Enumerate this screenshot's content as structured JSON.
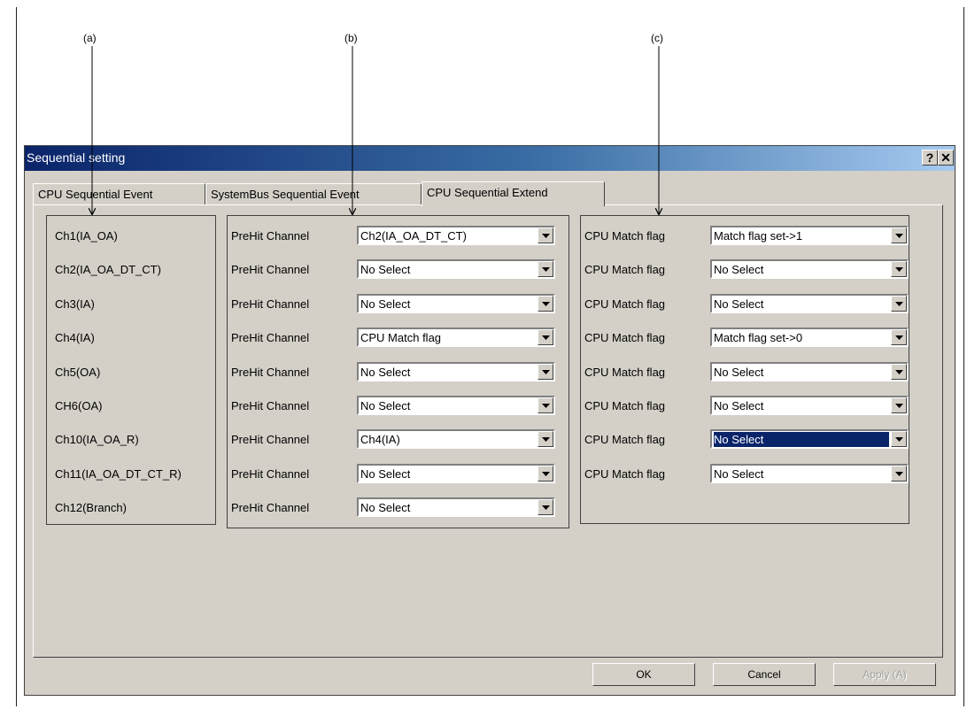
{
  "callouts": {
    "a": "(a)",
    "b": "(b)",
    "c": "(c)"
  },
  "dialog": {
    "title": "Sequential setting",
    "help_button": "?",
    "close_button": "✕"
  },
  "tabs": [
    {
      "label": "CPU Sequential Event"
    },
    {
      "label": "SystemBus Sequential Event"
    },
    {
      "label": "CPU Sequential Extend"
    }
  ],
  "channels": [
    {
      "name": "Ch1(IA_OA)",
      "prehit_label": "PreHit Channel",
      "prehit_value": "Ch2(IA_OA_DT_CT)"
    },
    {
      "name": "Ch2(IA_OA_DT_CT)",
      "prehit_label": "PreHit Channel",
      "prehit_value": "No Select"
    },
    {
      "name": "Ch3(IA)",
      "prehit_label": "PreHit Channel",
      "prehit_value": "No Select"
    },
    {
      "name": "Ch4(IA)",
      "prehit_label": "PreHit Channel",
      "prehit_value": "CPU Match flag"
    },
    {
      "name": "Ch5(OA)",
      "prehit_label": "PreHit Channel",
      "prehit_value": "No Select"
    },
    {
      "name": "CH6(OA)",
      "prehit_label": "PreHit Channel",
      "prehit_value": "No Select"
    },
    {
      "name": "Ch10(IA_OA_R)",
      "prehit_label": "PreHit Channel",
      "prehit_value": "Ch4(IA)"
    },
    {
      "name": "Ch11(IA_OA_DT_CT_R)",
      "prehit_label": "PreHit Channel",
      "prehit_value": "No Select"
    },
    {
      "name": "Ch12(Branch)",
      "prehit_label": "PreHit Channel",
      "prehit_value": "No Select"
    }
  ],
  "match_flags": [
    {
      "label": "CPU Match flag",
      "value": "Match flag set->1"
    },
    {
      "label": "CPU Match flag",
      "value": "No Select"
    },
    {
      "label": "CPU Match flag",
      "value": "No Select"
    },
    {
      "label": "CPU Match flag",
      "value": "Match flag set->0"
    },
    {
      "label": "CPU Match flag",
      "value": "No Select"
    },
    {
      "label": "CPU Match flag",
      "value": "No Select"
    },
    {
      "label": "CPU Match flag",
      "value": "No Select",
      "selected": true
    },
    {
      "label": "CPU Match flag",
      "value": "No Select"
    }
  ],
  "buttons": {
    "ok": "OK",
    "cancel": "Cancel",
    "apply": "Apply (A)"
  }
}
